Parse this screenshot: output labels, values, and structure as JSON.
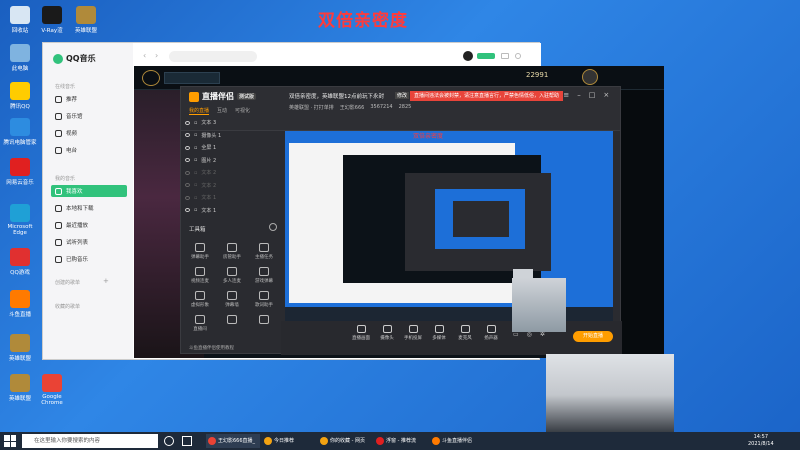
{
  "banner": "双倍亲密度",
  "desktop": {
    "icons": [
      {
        "label": "回收站",
        "color": "#d8e6f3"
      },
      {
        "label": "V-Ray渲",
        "color": "#1a1a1a"
      },
      {
        "label": "英雄联盟",
        "color": "#b08a3a"
      },
      {
        "label": "此电脑",
        "color": "#7fb3e0"
      },
      {
        "label": "腾讯QQ",
        "color": "#ffcc00"
      },
      {
        "label": "腾讯电脑管家",
        "color": "#2d8ce0"
      },
      {
        "label": "网易云音乐",
        "color": "#e02020"
      },
      {
        "label": "Microsoft Edge",
        "color": "#1fa0d6"
      },
      {
        "label": "QQ游戏",
        "color": "#e03030"
      },
      {
        "label": "斗鱼直播",
        "color": "#ff7a00"
      },
      {
        "label": "英雄联盟",
        "color": "#b08a3a"
      },
      {
        "label": "英雄联盟",
        "color": "#b08a3a"
      },
      {
        "label": "Google Chrome",
        "color": "#ea4335"
      }
    ]
  },
  "qqmusic": {
    "title": "QQ音乐",
    "sections": {
      "online": "在线音乐",
      "mine": "我的音乐",
      "created": "创建的歌单",
      "collected": "收藏的歌单"
    },
    "online_items": [
      "推荐",
      "音乐馆",
      "视频",
      "电台"
    ],
    "mine_items": [
      "我喜欢",
      "本地和下载",
      "最近播放",
      "试听列表",
      "已购音乐"
    ]
  },
  "live": {
    "app_name": "直播伴侣",
    "version_tag": "测试版",
    "stream_title": "双倍亲密度，英雄联盟12点前玩下永封",
    "tag_modify": "修改",
    "partition": "英雄联盟 · 打打单排",
    "host": "王幻影666",
    "room_id": "3567214",
    "fans": "2825",
    "tabs": [
      "我的直播",
      "互动",
      "可视化"
    ],
    "scenes": [
      {
        "name": "文本 3",
        "dim": false
      },
      {
        "name": "摄像头 1",
        "dim": false
      },
      {
        "name": "全屏 1",
        "dim": false
      },
      {
        "name": "图片 2",
        "dim": false
      },
      {
        "name": "文本 2",
        "dim": true
      },
      {
        "name": "文本 2",
        "dim": true
      },
      {
        "name": "文本 1",
        "dim": true
      },
      {
        "name": "文本 1",
        "dim": false
      }
    ],
    "toolbox": "工具箱",
    "tools": [
      "弹幕助手",
      "房管助手",
      "主播任务",
      "视频连麦",
      "多人连麦",
      "游戏弹幕",
      "虚拟形象",
      "弹幕墙",
      "歌词助手",
      "直播间",
      "",
      ""
    ],
    "bottom_buttons": [
      "直播画面",
      "摄像头",
      "手机投屏",
      "多媒体",
      "麦克风",
      "扬声器"
    ],
    "start_label": "开始直播",
    "notice": "斗鱼直播伴侣使用教程",
    "red_notice": "直播间违法会被封禁，请注意直播言行，严禁色情低俗，入驻帮助"
  },
  "preview_label": "直播预览画面",
  "taskbar": {
    "search_placeholder": "在这里输入你要搜索的内容",
    "apps": [
      {
        "label": "王幻影666直播_英...",
        "color": "#ea4335"
      },
      {
        "label": "今日推荐",
        "color": "#f3a312"
      },
      {
        "label": "你的收藏 - 网页",
        "color": "#f3a312"
      },
      {
        "label": "浮窗 - 推荐流",
        "color": "#e02020"
      },
      {
        "label": "斗鱼直播伴侣",
        "color": "#ff7a00"
      }
    ],
    "time": "14:57",
    "date": "2021/8/14"
  },
  "colors": {
    "accent": "#ff9d00",
    "qq_green": "#31c27c",
    "danger": "#e8443a"
  }
}
